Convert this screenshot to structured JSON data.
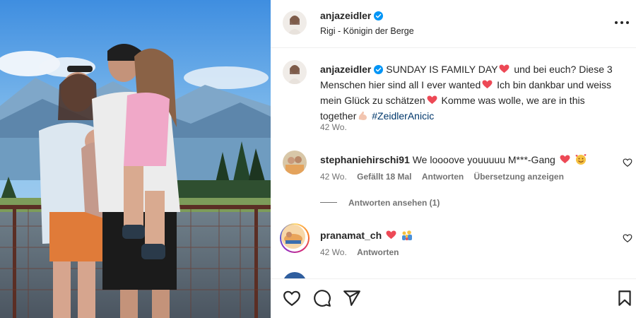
{
  "post": {
    "username": "anjazeidler",
    "location": "Rigi - Königin der Berge",
    "caption": {
      "username": "anjazeidler",
      "part1": "SUNDAY IS FAMILY DAY",
      "part2": "und bei euch? Diese 3 Menschen hier sind all I ever wanted",
      "part3": "Ich bin dankbar und weiss mein Glück zu schätzen",
      "part4": "Komme was wolle, we are in this together",
      "hashtag": "#ZeidlerAnicic",
      "time": "42 Wo."
    }
  },
  "comments": [
    {
      "username": "stephaniehirschi91",
      "text": "We loooove youuuuu M***-Gang",
      "time": "42 Wo.",
      "likes": "Gefällt 18 Mal",
      "reply_label": "Antworten",
      "translate_label": "Übersetzung anzeigen",
      "view_replies_label": "Antworten ansehen (1)"
    },
    {
      "username": "pranamat_ch",
      "text": "",
      "time": "42 Wo.",
      "reply_label": "Antworten"
    }
  ],
  "icons": {
    "more": "more-options-icon",
    "verified": "verified-badge-icon",
    "like": "heart-outline-icon",
    "comment": "comment-bubble-icon",
    "share": "paper-plane-icon",
    "save": "bookmark-icon"
  },
  "colors": {
    "verified": "#0095f6",
    "heart_emoji": "#ed4956",
    "hashtag": "#00376b",
    "secondary_text": "#737373"
  }
}
